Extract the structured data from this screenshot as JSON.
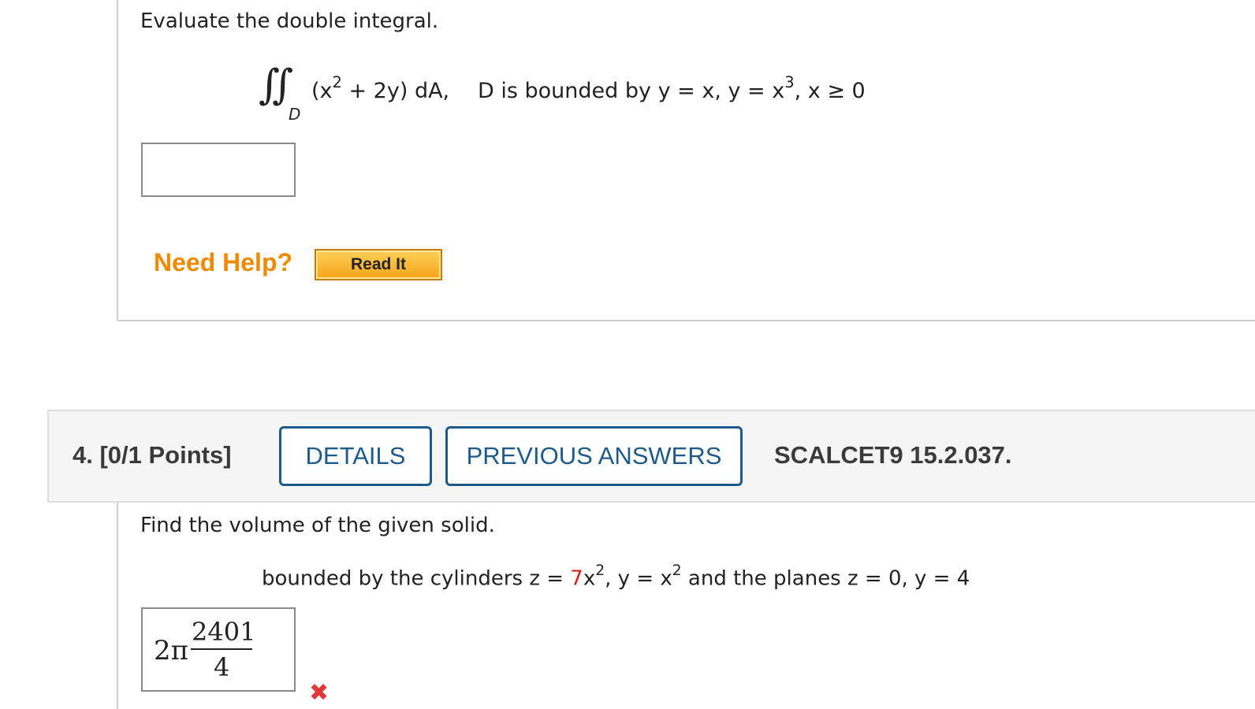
{
  "q3": {
    "prompt": "Evaluate the double integral.",
    "integral_sign": "∬",
    "integral_sub": "D",
    "integrand_a": "(x",
    "integrand_exp": "2",
    "integrand_b": " + 2y) dA,",
    "region_a": "D is bounded by y = x, y = x",
    "region_exp": "3",
    "region_b": ", x ≥ 0",
    "answer_value": "",
    "help_label": "Need Help?",
    "read_it_label": "Read It"
  },
  "q4": {
    "number_points": "4.  [0/1 Points]",
    "details_label": "DETAILS",
    "previous_answers_label": "PREVIOUS ANSWERS",
    "code": "SCALCET9 15.2.037.",
    "prompt": "Find the volume of the given solid.",
    "desc_a": "bounded by the cylinders z = ",
    "desc_red": "7",
    "desc_b": "x",
    "desc_exp1": "2",
    "desc_c": ", y = x",
    "desc_exp2": "2",
    "desc_d": " and the planes z = 0, y = 4",
    "answer_prefix": "2π",
    "answer_numerator": "2401",
    "answer_denominator": "4",
    "status_mark": "✖"
  },
  "colors": {
    "need_help": "#f08a00",
    "button_border": "#1f5a8c",
    "incorrect": "#e0393a",
    "highlight_red": "#d0201a"
  }
}
